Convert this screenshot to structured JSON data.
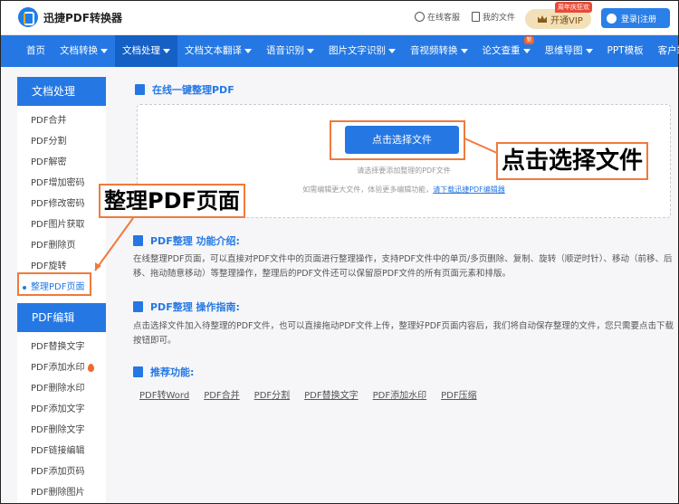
{
  "header": {
    "logo_text": "迅捷PDF转换器",
    "service_label": "在线客服",
    "docs_label": "我的文件",
    "vip_label": "开通VIP",
    "vip_tag": "周年庆狂欢",
    "login_label": "登录|注册"
  },
  "nav": {
    "items": [
      {
        "label": "首页",
        "caret": false
      },
      {
        "label": "文档转换",
        "caret": true
      },
      {
        "label": "文档处理",
        "caret": true,
        "active": true
      },
      {
        "label": "文档文本翻译",
        "caret": true
      },
      {
        "label": "语音识别",
        "caret": true
      },
      {
        "label": "图片文字识别",
        "caret": true
      },
      {
        "label": "音视频转换",
        "caret": true
      },
      {
        "label": "论文查重",
        "caret": true,
        "badge": "新"
      },
      {
        "label": "思维导图",
        "caret": true
      },
      {
        "label": "PPT模板",
        "caret": false
      },
      {
        "label": "客户端",
        "caret": true
      }
    ]
  },
  "sidebar": {
    "group1_title": "文档处理",
    "group1_items": [
      "PDF合并",
      "PDF分割",
      "PDF解密",
      "PDF增加密码",
      "PDF修改密码",
      "PDF图片获取",
      "PDF删除页",
      "PDF旋转",
      "整理PDF页面"
    ],
    "active_item": "整理PDF页面",
    "group2_title": "PDF编辑",
    "group2_items": [
      "PDF替换文字",
      "PDF添加水印",
      "PDF删除水印",
      "PDF添加文字",
      "PDF删除文字",
      "PDF链接编辑",
      "PDF添加页码",
      "PDF删除图片"
    ]
  },
  "main": {
    "section1_title": "在线一键整理PDF",
    "choose_button": "点击选择文件",
    "hint1": "请选择要添加整理的PDF文件",
    "hint2_prefix": "如需编辑更大文件，体验更多编辑功能，",
    "hint2_link": "请下载迅捷PDF编辑器",
    "intro_title": "PDF整理 功能介绍:",
    "intro_text": "在线整理PDF页面，可以直接对PDF文件中的页面进行整理操作，支持PDF文件中的单页/多页删除、复制、旋转（顺逆时针）、移动（前移、后移、拖动随意移动）等整理操作，整理后的PDF文件还可以保留原PDF文件的所有页面元素和排版。",
    "guide_title": "PDF整理 操作指南:",
    "guide_text": "点击选择文件加入待整理的PDF文件，也可以直接拖动PDF文件上传，整理好PDF页面内容后，我们将自动保存整理的文件，您只需要点击下载按钮即可。",
    "rec_title": "推荐功能:",
    "rec_links": [
      "PDF转Word",
      "PDF合并",
      "PDF分割",
      "PDF替换文字",
      "PDF添加水印",
      "PDF压缩"
    ]
  },
  "annotations": {
    "callout_right": "点击选择文件",
    "callout_left": "整理PDF页面"
  },
  "colors": {
    "brand_blue": "#2578e3",
    "annotation_orange": "#f07a3c"
  }
}
